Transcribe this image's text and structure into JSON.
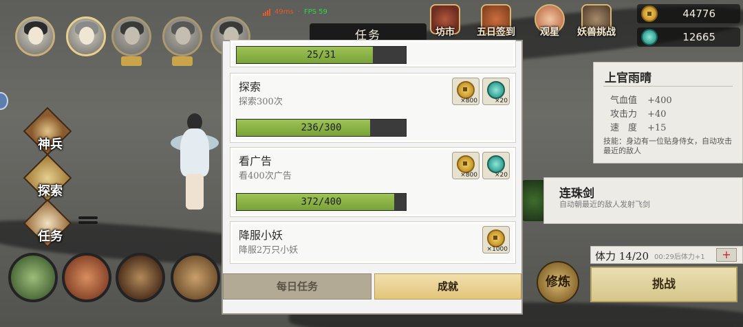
{
  "status": {
    "ping": "49ms",
    "fps": "FPS 59"
  },
  "top_nav": [
    {
      "label": "坊市",
      "icon": "market-icon"
    },
    {
      "label": "五日签到",
      "icon": "checkin-icon"
    },
    {
      "label": "观星",
      "icon": "stargazing-icon"
    },
    {
      "label": "妖兽挑战",
      "icon": "beast-challenge-icon"
    }
  ],
  "currency": {
    "coins": "44776",
    "jade": "12665"
  },
  "left_menu": [
    {
      "label": "神兵"
    },
    {
      "label": "探索"
    },
    {
      "label": "任务"
    }
  ],
  "character": {
    "name": "上官雨晴",
    "stats": [
      {
        "label": "气血值",
        "value": "+400"
      },
      {
        "label": "攻击力",
        "value": "+40"
      },
      {
        "label": "速　度",
        "value": "+15"
      }
    ],
    "skill": "技能：身边有一位贴身侍女，自动攻击最近的敌人"
  },
  "weapon": {
    "name": "连珠剑",
    "desc": "自动朝最近的敌人发射飞剑"
  },
  "stamina": {
    "label": "体力 14/20",
    "timer": "00:29后体力+1",
    "plus": "+"
  },
  "buttons": {
    "challenge": "挑战",
    "cultivate": "修炼"
  },
  "modal": {
    "title": "任务",
    "tasks": [
      {
        "name": "",
        "desc": "",
        "progress_text": "25/31",
        "progress": 0.806,
        "rewards": []
      },
      {
        "name": "探索",
        "desc": "探索300次",
        "progress_text": "236/300",
        "progress": 0.787,
        "rewards": [
          {
            "icon": "coin-icon",
            "count": "×800"
          },
          {
            "icon": "jade-icon",
            "count": "×20"
          }
        ]
      },
      {
        "name": "看广告",
        "desc": "看400次广告",
        "progress_text": "372/400",
        "progress": 0.93,
        "rewards": [
          {
            "icon": "coin-icon",
            "count": "×800"
          },
          {
            "icon": "jade-icon",
            "count": "×20"
          }
        ]
      },
      {
        "name": "降服小妖",
        "desc": "降服2万只小妖",
        "progress_text": "",
        "progress": null,
        "rewards": [
          {
            "icon": "coin-icon",
            "count": "×1000"
          }
        ]
      }
    ],
    "tabs": {
      "daily": "每日任务",
      "achievement": "成就"
    }
  },
  "colors": {
    "progress_fill": "#8fb84a",
    "progress_track": "#3b3b3b",
    "active_tab": "#e8cf8e"
  }
}
